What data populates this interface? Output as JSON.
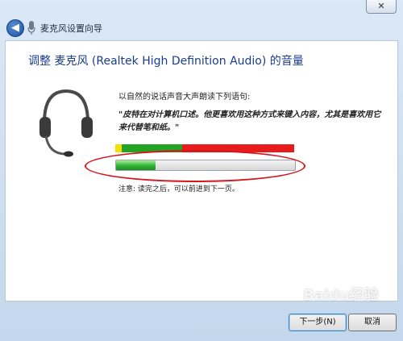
{
  "window": {
    "title": "麦克风设置向导",
    "close_label": "✕"
  },
  "main": {
    "heading": "调整 麦克风 (Realtek High Definition Audio) 的音量",
    "instruction": "以自然的说话声音大声朗读下列语句:",
    "read_text": "\"皮特在对计算机口述。他更喜欢用这种方式来键入内容，尤其是喜欢用它来代替笔和纸。\"",
    "volume_meter": {
      "colors": [
        "#f5e000",
        "#23a323",
        "#e81c1c"
      ]
    },
    "input_level_fraction": 0.22,
    "note": "注意: 读完之后，可以前进到下一页。"
  },
  "footer": {
    "next_label": "下一步(N)",
    "cancel_label": "取消"
  },
  "watermark": "Baidu经验"
}
